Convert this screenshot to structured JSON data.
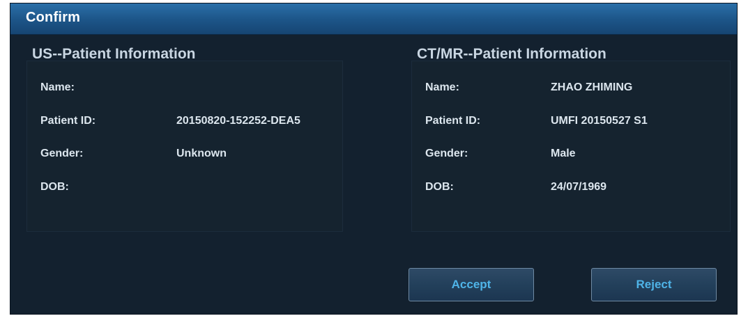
{
  "dialog": {
    "title": "Confirm"
  },
  "us_panel": {
    "heading": "US--Patient Information",
    "fields": [
      {
        "label": "Name:",
        "value": ""
      },
      {
        "label": "Patient ID:",
        "value": "20150820-152252-DEA5"
      },
      {
        "label": "Gender:",
        "value": "Unknown"
      },
      {
        "label": "DOB:",
        "value": ""
      }
    ]
  },
  "ctmr_panel": {
    "heading": "CT/MR--Patient Information",
    "fields": [
      {
        "label": "Name:",
        "value": "ZHAO ZHIMING"
      },
      {
        "label": "Patient ID:",
        "value": "UMFI 20150527 S1"
      },
      {
        "label": "Gender:",
        "value": "Male"
      },
      {
        "label": "DOB:",
        "value": "24/07/1969"
      }
    ]
  },
  "buttons": {
    "accept_label": "Accept",
    "reject_label": "Reject"
  },
  "colors": {
    "background": "#13212f",
    "titlebar": "#1c5487",
    "button_text": "#4fb4e8",
    "text": "#dce6ee"
  }
}
